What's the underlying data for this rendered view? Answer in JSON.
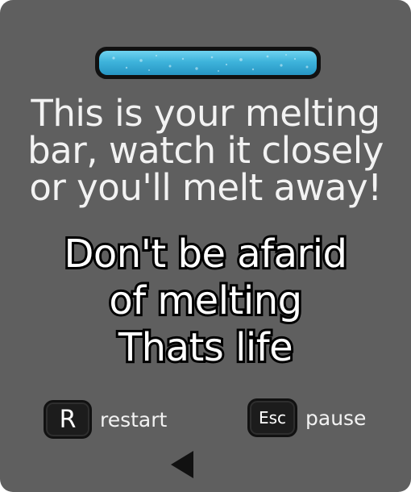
{
  "melt_bar": {
    "level": 1.0,
    "color": "#3eb3db"
  },
  "info": {
    "lines": [
      "This is your melting",
      "bar, watch it closely",
      "or you'll melt away!"
    ]
  },
  "motto": {
    "lines": [
      "Don't be afarid",
      "of melting",
      "Thats life"
    ]
  },
  "controls": {
    "restart": {
      "key": "R",
      "label": "restart"
    },
    "pause": {
      "key": "Esc",
      "label": "pause"
    }
  },
  "navigation": {
    "back_icon": "triangle-left-icon"
  }
}
